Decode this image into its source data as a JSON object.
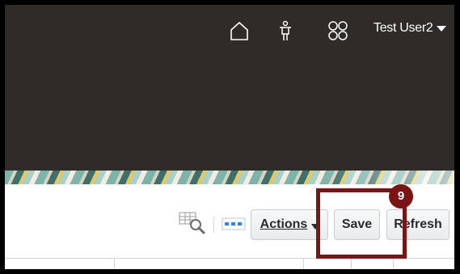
{
  "header": {
    "user_name": "Test User2"
  },
  "toolbar": {
    "actions_label": "Actions",
    "save_label": "Save",
    "refresh_label": "Refresh"
  },
  "callout": {
    "step_number": "9"
  },
  "colors": {
    "header_bg": "#2f2b28",
    "highlight": "#7a1415",
    "button_border": "#c9cdd1"
  },
  "icons": [
    "home-icon",
    "accessibility-icon",
    "apps-grid-icon",
    "user-menu-chevron-icon",
    "query-by-example-icon",
    "freeze-columns-icon",
    "actions-dropdown-icon"
  ]
}
